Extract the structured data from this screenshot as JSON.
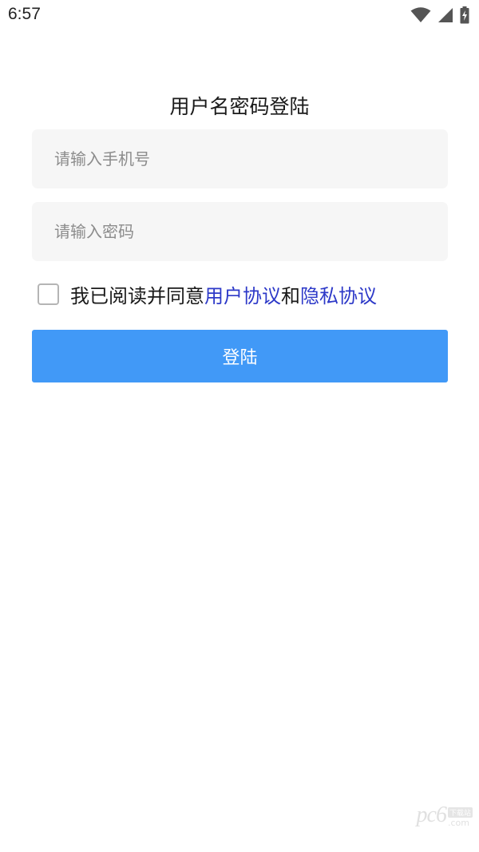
{
  "status_bar": {
    "time": "6:57",
    "icons": [
      "wifi-icon",
      "signal-icon",
      "battery-charging-icon"
    ]
  },
  "login": {
    "title": "用户名密码登陆",
    "phone_placeholder": "请输入手机号",
    "password_placeholder": "请输入密码",
    "agreement": {
      "prefix": "我已阅读并同意",
      "user_agreement_link": "用户协议",
      "conjunction": "和",
      "privacy_link": "隐私协议",
      "checked": false
    },
    "submit_label": "登陆"
  },
  "watermark": {
    "logo": "pc6",
    "badge": "下载站",
    "domain": ".com"
  },
  "colors": {
    "primary_button": "#4199f7",
    "link": "#2d39c8",
    "field_background": "#f6f6f6"
  }
}
